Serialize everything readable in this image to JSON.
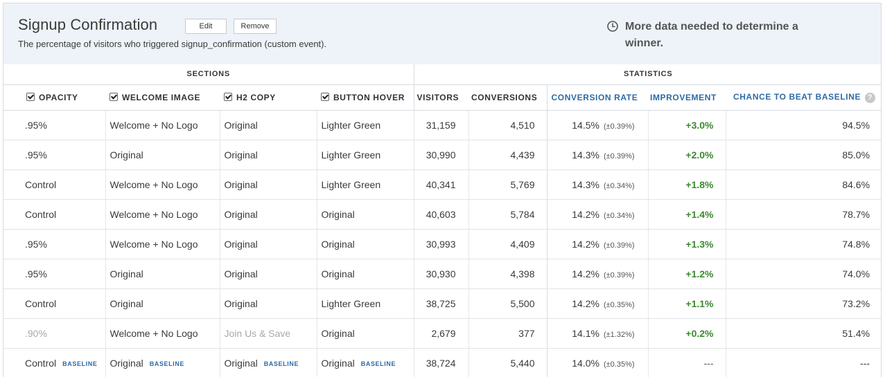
{
  "experiment": {
    "title": "Signup Confirmation",
    "edit_label": "Edit",
    "remove_label": "Remove",
    "subtitle": "The percentage of visitors who triggered signup_confirmation (custom event).",
    "status": "More data needed to determine a winner."
  },
  "table": {
    "groups": {
      "sections": "SECTIONS",
      "statistics": "STATISTICS"
    },
    "columns": {
      "opacity": "OPACITY",
      "welcome_image": "WELCOME IMAGE",
      "h2_copy": "H2 COPY",
      "button_hover": "BUTTON HOVER",
      "visitors": "VISITORS",
      "conversions": "CONVERSIONS",
      "conversion_rate": "CONVERSION RATE",
      "improvement": "IMPROVEMENT",
      "chance": "CHANCE TO BEAT BASELINE",
      "help": "?"
    },
    "baseline_label": "BASELINE",
    "rows": [
      {
        "opacity": ".95%",
        "welcome": "Welcome + No Logo",
        "h2": "Original",
        "hover": "Lighter Green",
        "visitors": "31,159",
        "conversions": "4,510",
        "rate": "14.5%",
        "ci": "(±0.39%)",
        "improvement": "+3.0%",
        "chance": "94.5%"
      },
      {
        "opacity": ".95%",
        "welcome": "Original",
        "h2": "Original",
        "hover": "Lighter Green",
        "visitors": "30,990",
        "conversions": "4,439",
        "rate": "14.3%",
        "ci": "(±0.39%)",
        "improvement": "+2.0%",
        "chance": "85.0%"
      },
      {
        "opacity": "Control",
        "welcome": "Welcome + No Logo",
        "h2": "Original",
        "hover": "Lighter Green",
        "visitors": "40,341",
        "conversions": "5,769",
        "rate": "14.3%",
        "ci": "(±0.34%)",
        "improvement": "+1.8%",
        "chance": "84.6%"
      },
      {
        "opacity": "Control",
        "welcome": "Welcome + No Logo",
        "h2": "Original",
        "hover": "Original",
        "visitors": "40,603",
        "conversions": "5,784",
        "rate": "14.2%",
        "ci": "(±0.34%)",
        "improvement": "+1.4%",
        "chance": "78.7%"
      },
      {
        "opacity": ".95%",
        "welcome": "Welcome + No Logo",
        "h2": "Original",
        "hover": "Original",
        "visitors": "30,993",
        "conversions": "4,409",
        "rate": "14.2%",
        "ci": "(±0.39%)",
        "improvement": "+1.3%",
        "chance": "74.8%"
      },
      {
        "opacity": ".95%",
        "welcome": "Original",
        "h2": "Original",
        "hover": "Original",
        "visitors": "30,930",
        "conversions": "4,398",
        "rate": "14.2%",
        "ci": "(±0.39%)",
        "improvement": "+1.2%",
        "chance": "74.0%"
      },
      {
        "opacity": "Control",
        "welcome": "Original",
        "h2": "Original",
        "hover": "Lighter Green",
        "visitors": "38,725",
        "conversions": "5,500",
        "rate": "14.2%",
        "ci": "(±0.35%)",
        "improvement": "+1.1%",
        "chance": "73.2%"
      },
      {
        "opacity": ".90%",
        "welcome": "Welcome + No Logo",
        "h2": "Join Us & Save",
        "hover": "Original",
        "visitors": "2,679",
        "conversions": "377",
        "rate": "14.1%",
        "ci": "(±1.32%)",
        "improvement": "+0.2%",
        "chance": "51.4%"
      },
      {
        "opacity": "Control",
        "welcome": "Original",
        "h2": "Original",
        "hover": "Original",
        "visitors": "38,724",
        "conversions": "5,440",
        "rate": "14.0%",
        "ci": "(±0.35%)",
        "improvement": "---",
        "chance": "---"
      }
    ]
  }
}
